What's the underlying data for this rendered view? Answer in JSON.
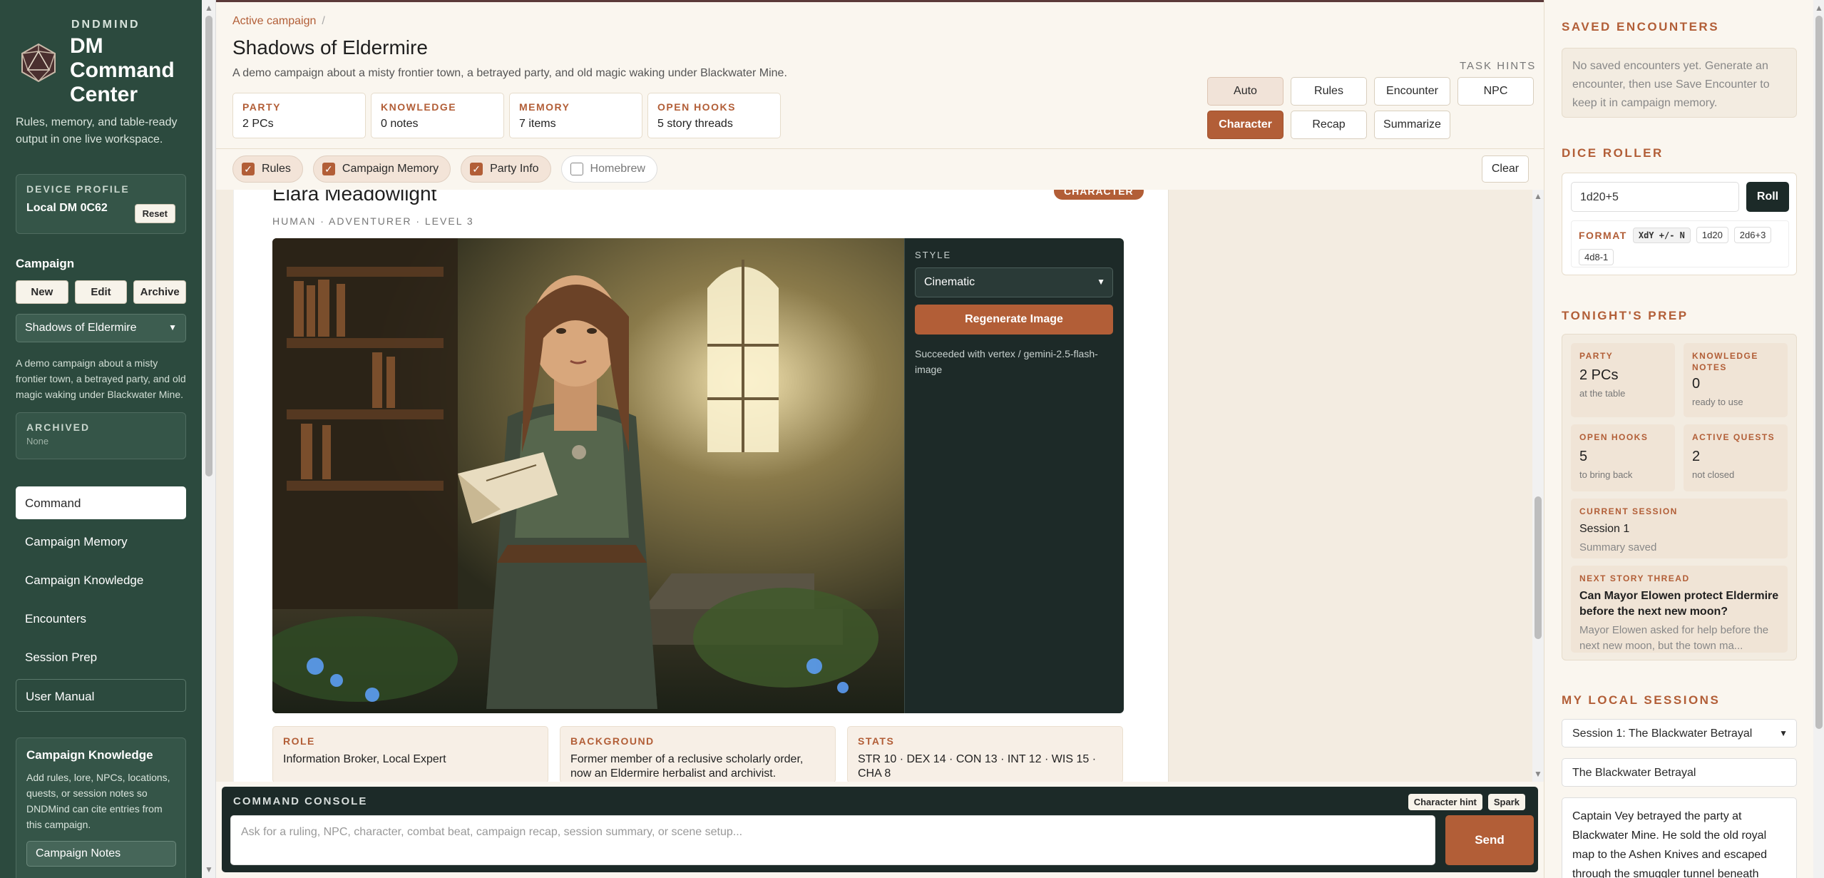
{
  "brand": {
    "kicker": "DNDMIND",
    "title": "DM Command Center",
    "tagline": "Rules, memory, and table-ready output in one live workspace."
  },
  "device": {
    "label": "DEVICE PROFILE",
    "name": "Local DM 0C62",
    "reset_label": "Reset"
  },
  "campaign": {
    "label": "Campaign",
    "new_label": "New",
    "edit_label": "Edit",
    "archive_label": "Archive",
    "selected": "Shadows of Eldermire",
    "description": "A demo campaign about a misty frontier town, a betrayed party, and old magic waking under Blackwater Mine.",
    "archived_label": "ARCHIVED",
    "archived_value": "None"
  },
  "nav": {
    "items": [
      "Command",
      "Campaign Memory",
      "Campaign Knowledge",
      "Encounters",
      "Session Prep",
      "User Manual"
    ]
  },
  "kb_panel": {
    "title": "Campaign Knowledge",
    "body": "Add rules, lore, NPCs, locations, quests, or session notes so DNDMind can cite entries from this campaign.",
    "button": "Campaign Notes"
  },
  "header": {
    "breadcrumb": "Active campaign",
    "breadcrumb_sep": "/",
    "title": "Shadows of Eldermire",
    "subtitle": "A demo campaign about a misty frontier town, a betrayed party, and old magic waking under Blackwater Mine.",
    "stats": [
      {
        "k": "PARTY",
        "v": "2 PCs"
      },
      {
        "k": "KNOWLEDGE",
        "v": "0 notes"
      },
      {
        "k": "MEMORY",
        "v": "7 items"
      },
      {
        "k": "OPEN HOOKS",
        "v": "5 story threads"
      }
    ]
  },
  "task_hints": {
    "label": "TASK HINTS",
    "buttons": [
      "Auto",
      "Rules",
      "Encounter",
      "NPC",
      "Character",
      "Recap",
      "Summarize"
    ]
  },
  "filters": {
    "chips": [
      "Rules",
      "Campaign Memory",
      "Party Info",
      "Homebrew"
    ],
    "check": "✓",
    "clear_label": "Clear"
  },
  "character": {
    "name": "Elara Meadowlight",
    "subtitle": "HUMAN · ADVENTURER · LEVEL 3",
    "badge": "CHARACTER",
    "style_label": "STYLE",
    "style_value": "Cinematic",
    "regen_label": "Regenerate Image",
    "status": "Succeeded with vertex / gemini-2.5-flash-image",
    "info": [
      {
        "k": "ROLE",
        "v": "Information Broker, Local Expert"
      },
      {
        "k": "BACKGROUND",
        "v": "Former member of a reclusive scholarly order, now an Eldermire herbalist and archivist."
      },
      {
        "k": "STATS",
        "v": "STR 10 · DEX 14 · CON 13 · INT 12 · WIS 15 · CHA 8"
      }
    ]
  },
  "console": {
    "title": "COMMAND CONSOLE",
    "tag_hint": "Character hint",
    "tag_spark": "Spark",
    "placeholder": "Ask for a ruling, NPC, character, combat beat, campaign recap, session summary, or scene setup...",
    "send_label": "Send"
  },
  "right": {
    "saved_title": "SAVED ENCOUNTERS",
    "saved_empty": "No saved encounters yet. Generate an encounter, then use Save Encounter to keep it in campaign memory.",
    "dice_title": "DICE ROLLER",
    "dice_value": "1d20+5",
    "roll_label": "Roll",
    "format_label": "FORMAT",
    "format_pills": [
      "XdY +/- N",
      "1d20",
      "2d6+3",
      "4d8-1"
    ],
    "prep_title": "TONIGHT'S PREP",
    "prep_cells": [
      {
        "k": "PARTY",
        "v": "2 PCs",
        "s": "at the table"
      },
      {
        "k": "KNOWLEDGE NOTES",
        "v": "0",
        "s": "ready to use"
      },
      {
        "k": "OPEN HOOKS",
        "v": "5",
        "s": "to bring back"
      },
      {
        "k": "ACTIVE QUESTS",
        "v": "2",
        "s": "not closed"
      }
    ],
    "current_session_k": "CURRENT SESSION",
    "current_session_v": "Session 1",
    "current_session_s": "Summary saved",
    "next_thread_k": "NEXT STORY THREAD",
    "next_thread_v": "Can Mayor Elowen protect Eldermire before the next new moon?",
    "next_thread_s": "Mayor Elowen asked for help before the next new moon, but the town ma...",
    "sessions_title": "MY LOCAL SESSIONS",
    "sessions_selected": "Session 1: The Blackwater Betrayal",
    "session_name": "The Blackwater Betrayal",
    "session_notes": "Captain Vey betrayed the party at Blackwater Mine. He sold the old royal map to the Ashen Knives and escaped through the smuggler tunnel beneath"
  },
  "colors": {
    "sidebar": "#2c4a3e",
    "accent": "#b25e37",
    "console": "#1c2a28",
    "paper": "#faf6ef"
  }
}
